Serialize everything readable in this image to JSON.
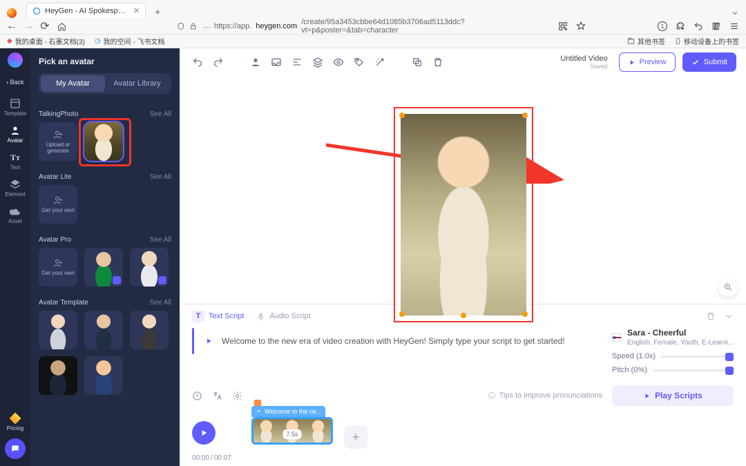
{
  "browser": {
    "tab_title": "HeyGen - AI Spokesperson Vid",
    "url_prefix": "https://app.",
    "url_host": "heygen.com",
    "url_path": "/create/95a3453cbbe64d1085b3706ad5113ddc?vt=p&poster=&tab=character",
    "badge": "1"
  },
  "bookmarks": {
    "left": [
      {
        "label": "我的桌面 - 石墨文档(3)"
      },
      {
        "label": "我的空间 - 飞书文档"
      }
    ],
    "right": [
      {
        "label": "其他书签"
      },
      {
        "label": "移动设备上的书签"
      }
    ]
  },
  "rail": {
    "back": "Back",
    "items": [
      {
        "key": "template",
        "label": "Template"
      },
      {
        "key": "avatar",
        "label": "Avatar"
      },
      {
        "key": "text",
        "label": "Text"
      },
      {
        "key": "element",
        "label": "Element"
      },
      {
        "key": "asset",
        "label": "Asset"
      }
    ],
    "pricing": "Pricing"
  },
  "panel": {
    "title": "Pick an avatar",
    "tabs": {
      "my": "My Avatar",
      "lib": "Avatar Library"
    },
    "see_all": "See All",
    "talkingphoto": {
      "title": "TalkingPhoto",
      "upload": "Upload or generate"
    },
    "lite": {
      "title": "Avatar Lite",
      "getown": "Get your own"
    },
    "pro": {
      "title": "Avatar Pro",
      "getown": "Get your own"
    },
    "template": {
      "title": "Avatar Template"
    }
  },
  "header": {
    "title": "Untitled Video",
    "status": "Saved",
    "preview": "Preview",
    "submit": "Submit"
  },
  "script": {
    "tabs": {
      "text": "Text Script",
      "audio": "Audio Script"
    },
    "body": "Welcome to the new era of video creation with HeyGen! Simply type your script to get started!",
    "tips": "Tips to improve pronunciations",
    "voice": {
      "name": "Sara - Cheerful",
      "desc": "English, Female, Youth, E-Learni..."
    },
    "speed": {
      "label": "Speed (1.0x)"
    },
    "pitch": {
      "label": "Pitch (0%)"
    },
    "play": "Play Scripts"
  },
  "timeline": {
    "clip_label": "Welcome to the ne...",
    "clip_dur": "7.5s",
    "pos": "00:00",
    "dur": "00:07"
  }
}
